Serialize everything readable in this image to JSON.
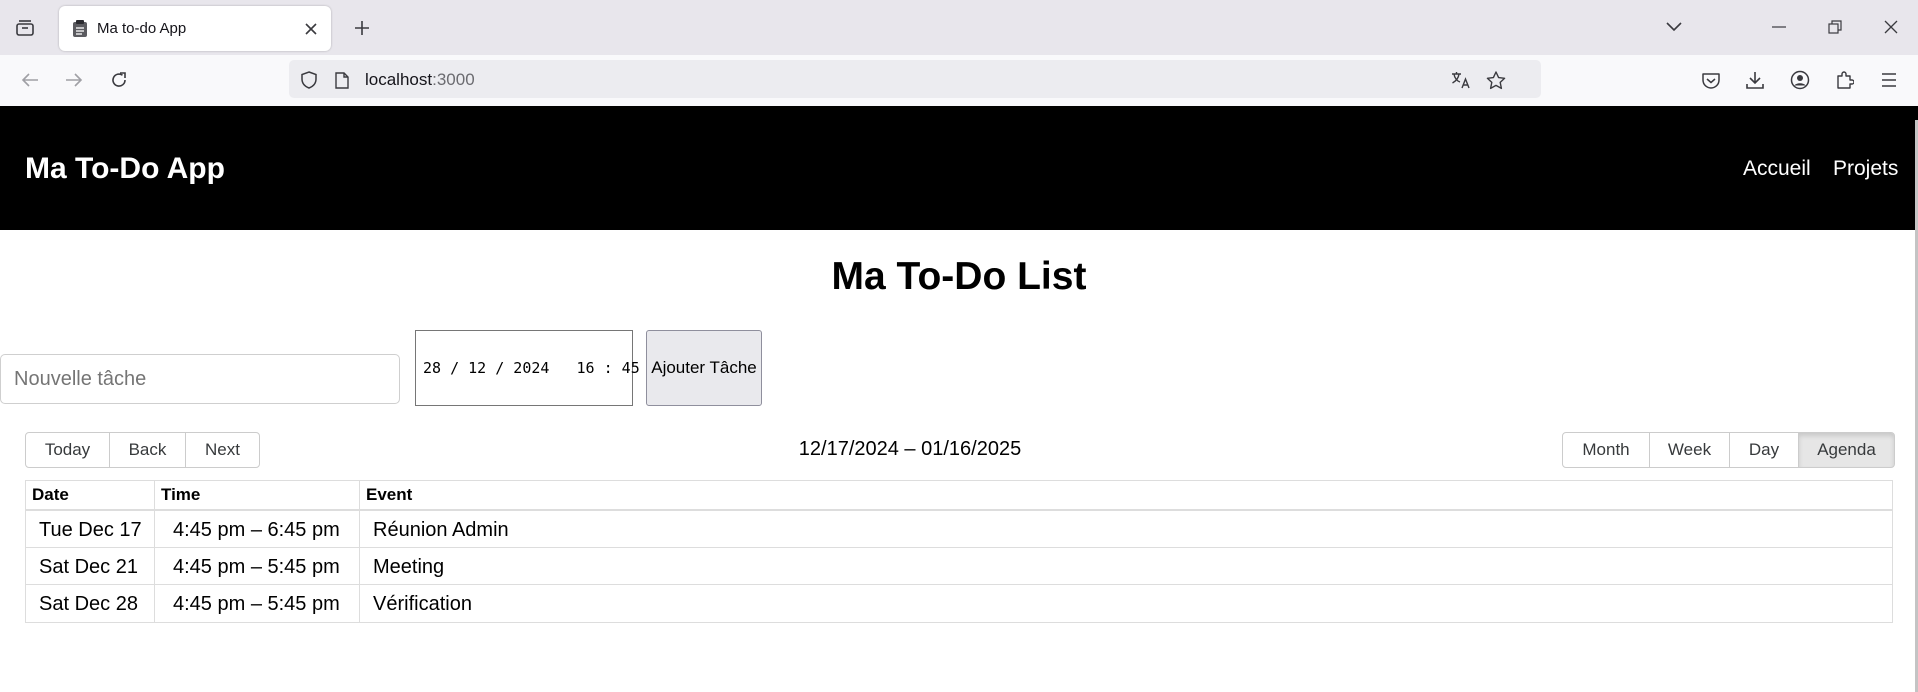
{
  "browser": {
    "tab_title": "Ma to-do App",
    "url_host": "localhost",
    "url_port": ":3000"
  },
  "app": {
    "title": "Ma To-Do App",
    "nav": [
      "Accueil",
      "Projets"
    ]
  },
  "main": {
    "page_title": "Ma To-Do List",
    "task_input_placeholder": "Nouvelle tâche",
    "datetime_value": "28 / 12 / 2024   16 : 45",
    "add_button": "Ajouter Tâche"
  },
  "calendar": {
    "nav_buttons": [
      "Today",
      "Back",
      "Next"
    ],
    "range_label": "12/17/2024 – 01/16/2025",
    "views": [
      "Month",
      "Week",
      "Day",
      "Agenda"
    ],
    "active_view": "Agenda",
    "columns": [
      "Date",
      "Time",
      "Event"
    ],
    "events": [
      {
        "date": "Tue Dec 17",
        "time": "4:45 pm – 6:45 pm",
        "event": "Réunion Admin"
      },
      {
        "date": "Sat Dec 21",
        "time": "4:45 pm – 5:45 pm",
        "event": "Meeting"
      },
      {
        "date": "Sat Dec 28",
        "time": "4:45 pm – 5:45 pm",
        "event": "Vérification"
      }
    ]
  },
  "icons": {
    "tab_list": "tab-list-icon",
    "tab_favicon": "clipboard-icon",
    "tab_close": "close-icon",
    "new_tab": "plus-icon",
    "back": "arrow-left-icon",
    "forward": "arrow-right-icon",
    "reload": "reload-icon",
    "shield": "shield-icon",
    "page": "page-icon",
    "translate": "translate-icon",
    "bookmark": "star-icon",
    "pocket": "pocket-icon",
    "downloads": "download-icon",
    "account": "account-icon",
    "extensions": "extensions-icon",
    "menu": "menu-icon",
    "calendar": "calendar-icon"
  }
}
